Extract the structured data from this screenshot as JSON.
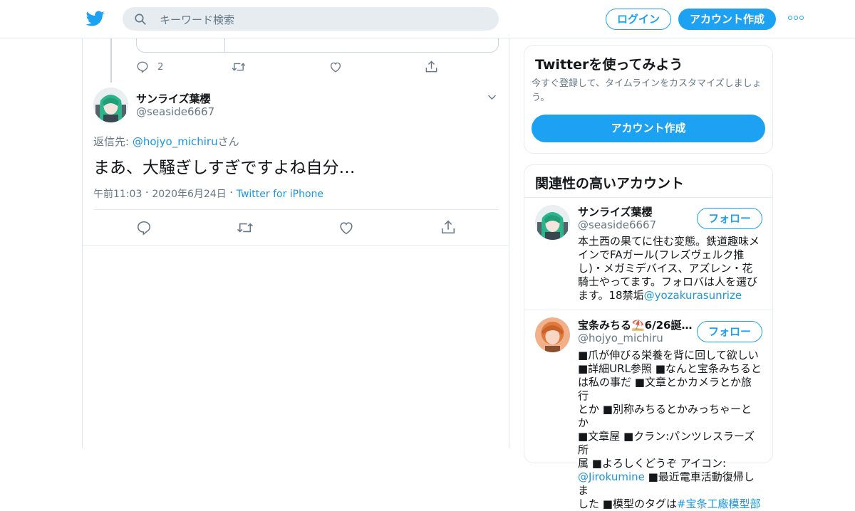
{
  "header": {
    "search_placeholder": "キーワード検索",
    "login_label": "ログイン",
    "signup_label": "アカウント作成"
  },
  "quoted_tweet_actions": {
    "reply_count": "2"
  },
  "tweet": {
    "author_name": "サンライズ葉櫻",
    "author_handle": "@seaside6667",
    "reply_prefix": "返信先: ",
    "reply_handle": "@hojyo_michiru",
    "reply_suffix": "さん",
    "text": "まあ、大騒ぎしすぎですよね自分…",
    "time": "午前11:03",
    "date": "2020年6月24日",
    "source": "Twitter for iPhone",
    "sep": "・"
  },
  "signup_card": {
    "title": "Twitterを使ってみよう",
    "description_line1": "今すぐ登録して、タイムラインをカスタマイズしましょ",
    "description_line2": "う。",
    "button_label": "アカウント作成"
  },
  "related": {
    "title": "関連性の高いアカウント",
    "follow_label": "フォロー",
    "accounts": [
      {
        "name": "サンライズ葉櫻",
        "handle": "@seaside6667",
        "bio_lines": [
          "本土西の果てに住む変態。鉄道趣味メ",
          "インでFAガール(フレズヴェルク推",
          "し)・メガミデバイス、アズレン・花",
          "騎士やってます。フォロバは人を選び"
        ],
        "bio_last_text": "ます。18禁垢",
        "bio_last_link": "@yozakurasunrize"
      },
      {
        "name": "宝条みちる⛱️6/26誕…",
        "handle": "@hojyo_michiru",
        "bio_lines": [
          "■爪が伸びる栄養を背に回して欲しい",
          "■詳細URL参照 ■なんと宝条みちると",
          "は私の事だ ■文章とかカメラとか旅行",
          "とか ■別称みちるとかみっちゃーとか",
          "■文章屋 ■クラン:パンツレスラーズ所",
          "属 ■よろしくどうぞ アイコン:"
        ],
        "bio_link_line_link": "@Jirokumine",
        "bio_link_line_text": " ■最近電車活動復帰しま",
        "bio_cut_text": "した ■模型のタグは",
        "bio_cut_link": "#宝条工廠模型部"
      }
    ]
  },
  "colors": {
    "brand_blue": "#1da1f2",
    "link_blue": "#1b95e0",
    "muted_gray": "#657786",
    "border": "#e6ecf0"
  },
  "icons": [
    "twitter-bird-icon",
    "search-icon",
    "more-icon",
    "reply-icon",
    "retweet-icon",
    "like-icon",
    "share-icon",
    "chevron-down-icon"
  ]
}
